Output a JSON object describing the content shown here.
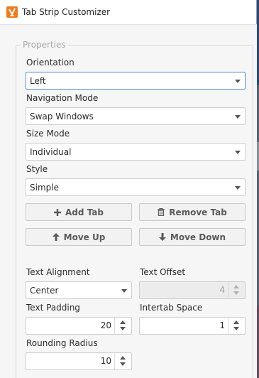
{
  "window": {
    "title": "Tab Strip Customizer",
    "icon": "customizer-app-icon",
    "accent": "#f07a1a"
  },
  "properties": {
    "legend": "Properties",
    "orientation": {
      "label": "Orientation",
      "value": "Left"
    },
    "navigation_mode": {
      "label": "Navigation Mode",
      "value": "Swap Windows"
    },
    "size_mode": {
      "label": "Size Mode",
      "value": "Individual"
    },
    "style": {
      "label": "Style",
      "value": "Simple"
    },
    "buttons": {
      "add_tab": "Add Tab",
      "remove_tab": "Remove Tab",
      "move_up": "Move Up",
      "move_down": "Move Down"
    },
    "text_alignment": {
      "label": "Text Alignment",
      "value": "Center"
    },
    "text_offset": {
      "label": "Text Offset",
      "value": "4"
    },
    "text_padding": {
      "label": "Text Padding",
      "value": "20"
    },
    "intertab_space": {
      "label": "Intertab Space",
      "value": "1"
    },
    "rounding_radius": {
      "label": "Rounding Radius",
      "value": "10"
    }
  }
}
